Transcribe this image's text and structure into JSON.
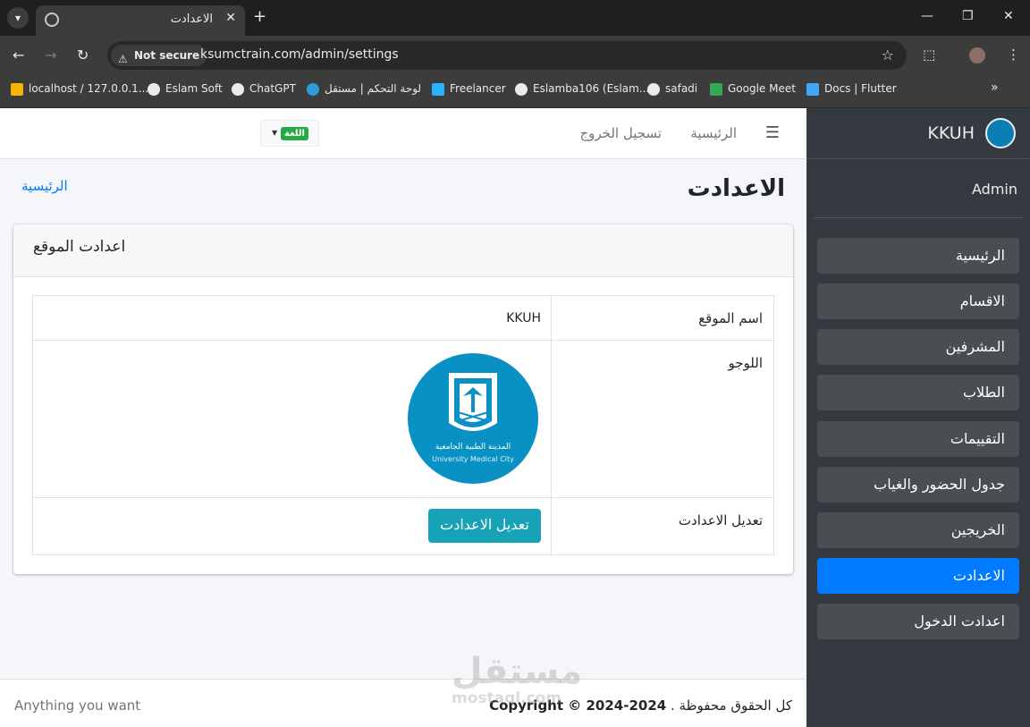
{
  "browser": {
    "tab_title": "الاعدادت",
    "not_secure": "Not secure",
    "url": "ksumctrain.com/admin/settings",
    "bookmarks": [
      {
        "label": "localhost / 127.0.0.1...",
        "color": "#f4b400"
      },
      {
        "label": "Eslam Soft",
        "color": "#e8eaed"
      },
      {
        "label": "ChatGPT",
        "color": "#e8eaed"
      },
      {
        "label": "لوحة التحكم | مستقل",
        "color": "#2d9cdb"
      },
      {
        "label": "Freelancer",
        "color": "#29b2fe"
      },
      {
        "label": "Eslamba106 (Eslam...",
        "color": "#e8eaed"
      },
      {
        "label": "safadi",
        "color": "#e8eaed"
      },
      {
        "label": "Google Meet",
        "color": "#34a853"
      },
      {
        "label": "Docs | Flutter",
        "color": "#42a5f5"
      }
    ]
  },
  "sidebar": {
    "brand": "KKUH",
    "user": "Admin",
    "items": [
      {
        "label": "الرئيسية",
        "active": false
      },
      {
        "label": "الاقسام",
        "active": false
      },
      {
        "label": "المشرفين",
        "active": false
      },
      {
        "label": "الطلاب",
        "active": false
      },
      {
        "label": "التقييمات",
        "active": false
      },
      {
        "label": "جدول الحضور والغياب",
        "active": false
      },
      {
        "label": "الخريجين",
        "active": false
      },
      {
        "label": "الاعدادت",
        "active": true
      },
      {
        "label": "اعدادت الدخول",
        "active": false
      }
    ]
  },
  "topnav": {
    "home": "الرئيسية",
    "logout": "تسجيل الخروج",
    "language": "اللغة"
  },
  "page": {
    "title": "الاعدادت",
    "breadcrumb": "الرئيسية"
  },
  "card": {
    "title": "اعدادت الموقع",
    "rows": {
      "site_name_label": "اسم الموقع",
      "site_name_value": "KKUH",
      "logo_label": "اللوجو",
      "logo_text_ar": "المدينة الطبية الجامعية",
      "logo_text_en": "University Medical City",
      "edit_label": "تعديل الاعدادت",
      "edit_button": "تعديل الاعدادت"
    }
  },
  "footer": {
    "left": "Anything you want",
    "copyright": "Copyright © 2024-2024",
    "rights": "كل الحقوق محفوظة ."
  },
  "watermark": {
    "main": "مستقل",
    "sub": "mostaql.com"
  },
  "colors": {
    "sidebar_bg": "#343a40",
    "active_item": "#007bff",
    "edit_button": "#17a2b8",
    "logo_blue": "#0a91c4"
  }
}
